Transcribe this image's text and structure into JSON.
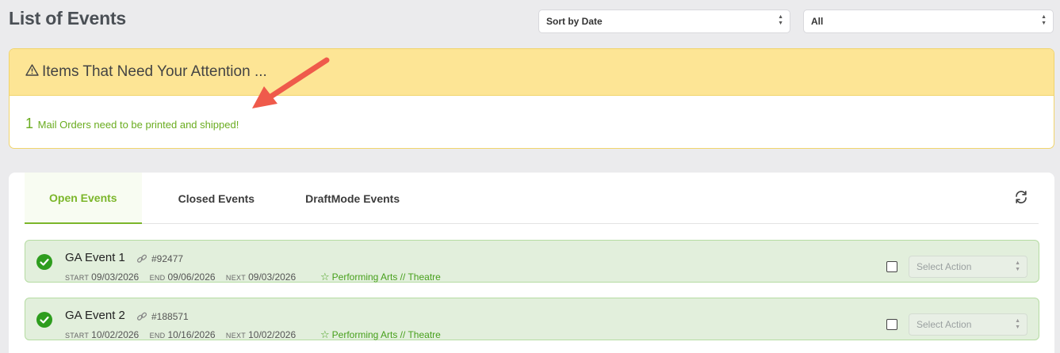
{
  "page": {
    "title": "List of Events"
  },
  "sort_select": {
    "value": "Sort by Date"
  },
  "filter_select": {
    "value": "All"
  },
  "attention": {
    "title": "Items That Need Your Attention ...",
    "count": "1",
    "message": "Mail Orders need to be printed and shipped!"
  },
  "tabs": [
    {
      "label": "Open Events",
      "active": true
    },
    {
      "label": "Closed Events",
      "active": false
    },
    {
      "label": "DraftMode Events",
      "active": false
    }
  ],
  "labels": {
    "start": "START",
    "end": "END",
    "next": "NEXT"
  },
  "events": [
    {
      "name": "GA Event 1",
      "id": "#92477",
      "start": "09/03/2026",
      "end": "09/06/2026",
      "next": "09/03/2026",
      "category": "Performing Arts // Theatre",
      "action_placeholder": "Select Action"
    },
    {
      "name": "GA Event 2",
      "id": "#188571",
      "start": "10/02/2026",
      "end": "10/16/2026",
      "next": "10/02/2026",
      "category": "Performing Arts // Theatre",
      "action_placeholder": "Select Action"
    }
  ],
  "colors": {
    "accent_green": "#7bb62a",
    "attention_yellow": "#fde595",
    "row_green": "#e2efdc",
    "arrow_red": "#ef5a4b"
  }
}
